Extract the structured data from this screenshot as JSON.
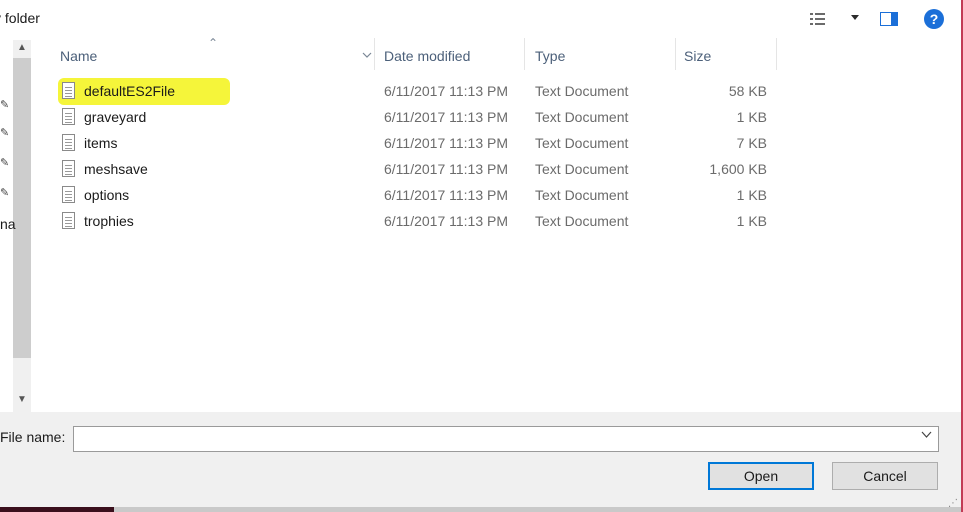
{
  "toolbar": {
    "new_folder_label": "v folder",
    "help_glyph": "?"
  },
  "nav": {
    "partial_label": "na"
  },
  "columns": {
    "name": "Name",
    "date": "Date modified",
    "type": "Type",
    "size": "Size"
  },
  "files": [
    {
      "name": "defaultES2File",
      "date": "6/11/2017 11:13 PM",
      "type": "Text Document",
      "size": "58 KB"
    },
    {
      "name": "graveyard",
      "date": "6/11/2017 11:13 PM",
      "type": "Text Document",
      "size": "1 KB"
    },
    {
      "name": "items",
      "date": "6/11/2017 11:13 PM",
      "type": "Text Document",
      "size": "7 KB"
    },
    {
      "name": "meshsave",
      "date": "6/11/2017 11:13 PM",
      "type": "Text Document",
      "size": "1,600 KB"
    },
    {
      "name": "options",
      "date": "6/11/2017 11:13 PM",
      "type": "Text Document",
      "size": "1 KB"
    },
    {
      "name": "trophies",
      "date": "6/11/2017 11:13 PM",
      "type": "Text Document",
      "size": "1 KB"
    }
  ],
  "footer": {
    "file_name_label": "File name:",
    "file_name_value": "",
    "open_label": "Open",
    "cancel_label": "Cancel"
  },
  "colors": {
    "highlight": "#f5f53a",
    "accent": "#0078d7"
  }
}
